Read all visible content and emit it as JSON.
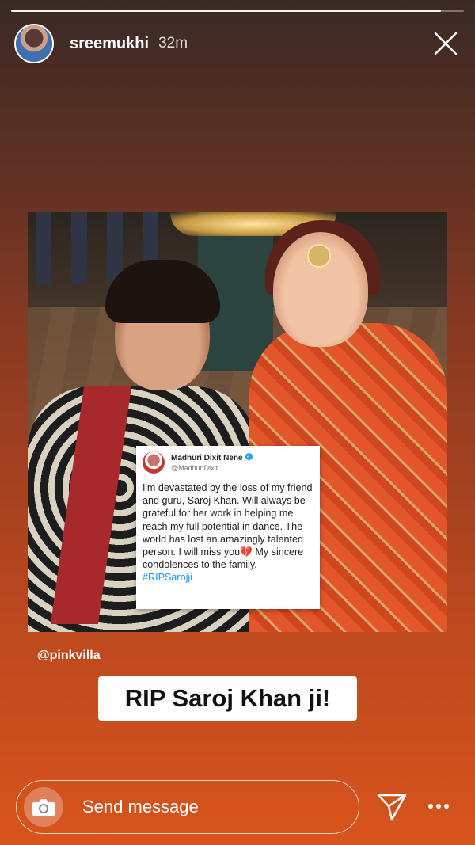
{
  "story": {
    "progress": 0.95,
    "username": "sreemukhi",
    "time": "32m"
  },
  "icons": {
    "close": "close-icon",
    "camera": "camera-icon",
    "send": "send-icon",
    "more": "more-icon"
  },
  "tweet": {
    "name": "Madhuri Dixit Nene",
    "handle": "@MadhuriDixit",
    "text": "I'm devastated by the loss of my friend and guru, Saroj Khan. Will always be grateful for her work in helping me reach my full potential in dance. The world has lost an amazingly talented person. I will miss you💔 My sincere condolences to the family.",
    "hashtag": "#RIPSarojji"
  },
  "mention": "@pinkvilla",
  "sticker_text": "RIP Saroj Khan ji!",
  "composer": {
    "placeholder": "Send message"
  },
  "colors": {
    "background_top": "#3a2a25",
    "background_bottom": "#d8541c",
    "verified_badge": "#1da1f2",
    "hashtag": "#1b95e0"
  }
}
